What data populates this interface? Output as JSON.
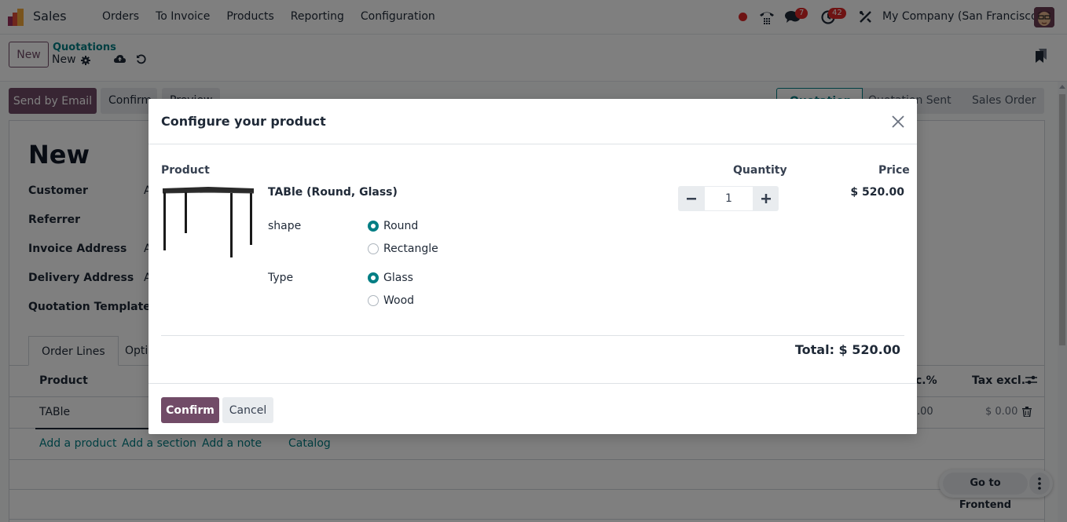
{
  "navbar": {
    "app_name": "Sales",
    "menu": [
      "Orders",
      "To Invoice",
      "Products",
      "Reporting",
      "Configuration"
    ],
    "messages_count": "7",
    "activities_count": "42",
    "company": "My Company (San Francisco)"
  },
  "control_panel": {
    "new_button": "New",
    "breadcrumb_parent": "Quotations",
    "breadcrumb_current": "New"
  },
  "actions": {
    "send_email": "Send by Email",
    "confirm": "Confirm",
    "preview": "Preview"
  },
  "statusbar": {
    "stages": [
      "Quotation",
      "Quotation Sent",
      "Sales Order"
    ],
    "active": "Quotation"
  },
  "form": {
    "title": "New",
    "fields": [
      {
        "label": "Customer",
        "value": "A"
      },
      {
        "label": "Referrer",
        "value": ""
      },
      {
        "label": "Invoice Address",
        "value": "A"
      },
      {
        "label": "Delivery Address",
        "value": "A"
      },
      {
        "label": "Quotation Template",
        "value": ""
      }
    ],
    "tabs": [
      "Order Lines",
      "Opti"
    ],
    "list": {
      "col_product": "Product",
      "col_disc": "c.%",
      "col_tax": "Tax excl.",
      "rows": [
        {
          "product": "TABle",
          "disc": ".00",
          "tax_excl": "$ 0.00"
        }
      ],
      "add_links": [
        "Add a product",
        "Add a section",
        "Add a note",
        "Catalog"
      ]
    }
  },
  "frontend": {
    "label": "Go to Frontend"
  },
  "modal": {
    "title": "Configure your product",
    "col_product": "Product",
    "col_quantity": "Quantity",
    "col_price": "Price",
    "product_name": "TABle (Round, Glass)",
    "attributes": [
      {
        "name": "shape",
        "options": [
          {
            "label": "Round",
            "checked": true
          },
          {
            "label": "Rectangle",
            "checked": false
          }
        ]
      },
      {
        "name": "Type",
        "options": [
          {
            "label": "Glass",
            "checked": true
          },
          {
            "label": "Wood",
            "checked": false
          }
        ]
      }
    ],
    "quantity": "1",
    "price": "$ 520.00",
    "total": "Total: $ 520.00",
    "confirm": "Confirm",
    "cancel": "Cancel"
  },
  "colors": {
    "brand": "#714b67",
    "accent": "#017e84",
    "badge": "#dc2626"
  }
}
